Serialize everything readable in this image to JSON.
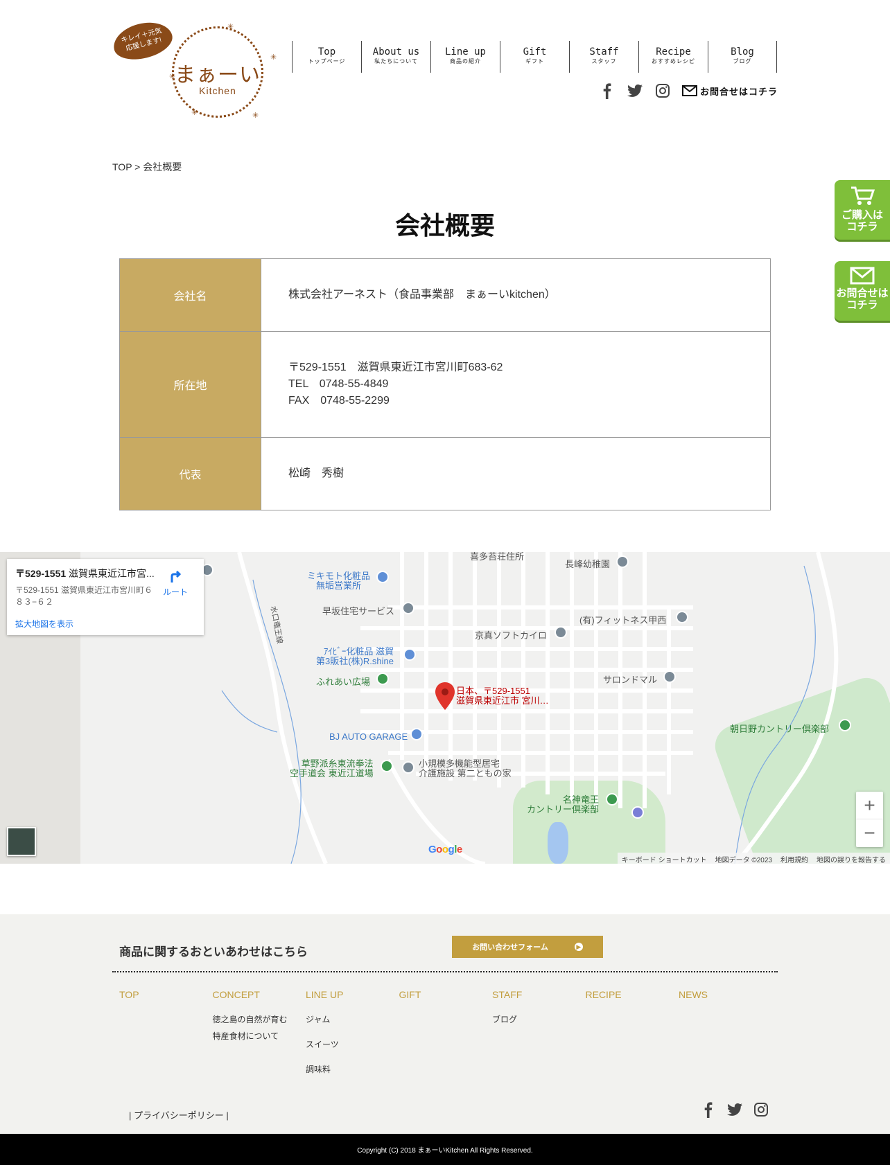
{
  "logo": {
    "bubble_line1": "キレイ＋元気",
    "bubble_line2": "応援します!",
    "main": "まぁーい",
    "sub": "Kitchen",
    "brand_color": "#8a4a18"
  },
  "nav": [
    {
      "en": "Top",
      "ja": "トップページ"
    },
    {
      "en": "About us",
      "ja": "私たちについて"
    },
    {
      "en": "Line up",
      "ja": "商品の紹介"
    },
    {
      "en": "Gift",
      "ja": "ギフト"
    },
    {
      "en": "Staff",
      "ja": "スタッフ"
    },
    {
      "en": "Recipe",
      "ja": "おすすめレシピ"
    },
    {
      "en": "Blog",
      "ja": "ブログ"
    }
  ],
  "header": {
    "contact_label": "お問合せはコチラ",
    "social_icons": [
      "facebook-icon",
      "twitter-icon",
      "instagram-icon"
    ]
  },
  "breadcrumb": "TOP > 会社概要",
  "page_title": "会社概要",
  "company_table": {
    "accent_color": "#c8aa62",
    "rows": [
      {
        "label": "会社名",
        "lines": [
          "株式会社アーネスト（食品事業部　まぁーいkitchen）"
        ]
      },
      {
        "label": "所在地",
        "lines": [
          "〒529-1551　滋賀県東近江市宮川町683-62",
          "TEL　0748-55-4849",
          "FAX　0748-55-2299"
        ]
      },
      {
        "label": "代表",
        "lines": [
          "松崎　秀樹"
        ]
      }
    ]
  },
  "side_buttons": [
    {
      "label_line1": "ご購入は",
      "label_line2": "コチラ",
      "icon": "cart-icon"
    },
    {
      "label_line1": "お問合せは",
      "label_line2": "コチラ",
      "icon": "mail-icon"
    }
  ],
  "map": {
    "card_title_bold": "〒529-1551",
    "card_title_rest": " 滋賀県東近江市宮...",
    "card_address": "〒529-1551 滋賀県東近江市宮川町６８３−６２",
    "route_label": "ルート",
    "larger_map_link": "拡大地図を表示",
    "pin_label_line1": "日本、〒529-1551",
    "pin_label_line2": "滋賀県東近江市 宮川…",
    "places": {
      "mikimoto": "ミキモト化粧品\n無垢営業所",
      "hayasaka": "早坂住宅サービス",
      "kyoshin": "京真ソフトカイロ",
      "fitness": "(有)フィットネス甲西",
      "nagasaki": "長峰幼稚園",
      "top_cut": "喜多苔荘住所",
      "aibi": "ｱｲﾋﾞｰ化粧品 滋賀\n第3販社(株)R.shine",
      "fureai": "ふれあい広場",
      "salon": "サロンドマル",
      "asahino": "朝日野カントリー倶楽部",
      "bj": "BJ AUTO GARAGE",
      "karate": "草野派糸東流拳法\n空手道会 東近江道場",
      "kaigo": "小規模多機能型居宅\n介護施設 第二ともの家",
      "meishin": "名神竜王\nカントリー倶楽部",
      "road": "水口竜王線"
    },
    "google": "Google",
    "footer_links": [
      "キーボード ショートカット",
      "地図データ ©2023",
      "利用規約",
      "地図の誤りを報告する"
    ],
    "zoom_in": "+",
    "zoom_out": "−"
  },
  "footer": {
    "ask": "商品に関するおといあわせはこちら",
    "form_button": "お問い合わせフォーム",
    "columns": [
      {
        "head": "TOP",
        "items": []
      },
      {
        "head": "CONCEPT",
        "items": [
          "徳之島の自然が育む",
          "特産食材について"
        ]
      },
      {
        "head": "LINE UP",
        "items": [
          "ジャム",
          "スイーツ",
          "調味料"
        ]
      },
      {
        "head": "GIFT",
        "items": []
      },
      {
        "head": "STAFF",
        "items": [
          "ブログ"
        ]
      },
      {
        "head": "RECIPE",
        "items": []
      },
      {
        "head": "NEWS",
        "items": []
      }
    ],
    "privacy": "|  プライバシーポリシー  |",
    "accent_color": "#c29e3e",
    "copyright": "Copyright (C) 2018 まぁーいKitchen All Rights Reserved."
  }
}
